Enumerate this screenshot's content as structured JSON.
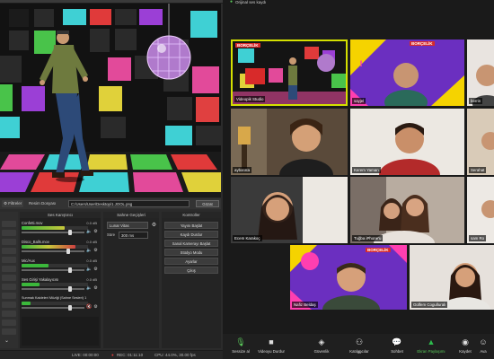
{
  "obs": {
    "filter_tab": "Filtreler",
    "image_file_label": "Resim Dosyası",
    "image_path": "C:/Users/User/Desktop/1.JOOL.png",
    "browse_label": "Gözat",
    "panels": {
      "mixer": "Ses Karıştırıcı",
      "transitions": "Sahne Geçişleri",
      "controls": "Kontroller"
    },
    "mixer_tracks": [
      {
        "name": "Confetti.mov",
        "db": "0.0 dB"
      },
      {
        "name": "Disco_Balls.mov",
        "db": "0.0 dB"
      },
      {
        "name": "Mic/Aux",
        "db": "0.0 dB"
      },
      {
        "name": "Ses Girişi Yakalayıcısı",
        "db": "0.0 dB"
      },
      {
        "name": "Sunmak Kaideleri Müziği (Sahne Sesleri) 1",
        "db": "0.0 dB"
      }
    ],
    "transition_value": "Lunar Vitas",
    "duration_label": "Süre",
    "duration_value": "300 ms",
    "control_buttons": [
      "Yayını Başlat",
      "Kaydı Durdur",
      "Sanal Kamerayı Başlat",
      "Stüdyo Modu",
      "Ayarlar",
      "Çıkış"
    ],
    "status": {
      "live": "LIVE: 00:00:00",
      "rec": "REC: 01:11:10",
      "cpu": "CPU: 44.0%, 30.00 fps"
    }
  },
  "zoom": {
    "top_label": "Orijinal ses kaydı",
    "participants": [
      {
        "name": "Videopik Studio"
      },
      {
        "name": "sayjel"
      },
      {
        "name": "berrin"
      },
      {
        "name": "aybarata"
      },
      {
        "name": "Kerem Yaman"
      },
      {
        "name": "Serahat"
      },
      {
        "name": "Ecem Karakoç"
      },
      {
        "name": "Tuğba iPhone'u"
      },
      {
        "name": "sam Ro"
      },
      {
        "name": "Nafiz Beldaş"
      },
      {
        "name": "Gülfem Cogulluralı"
      }
    ],
    "logo_text": "BORÇELİK",
    "logo_text_short": "BORÇE",
    "toolbar": [
      {
        "label": "Sessize al",
        "icon": "mic-icon"
      },
      {
        "label": "Videoyu Durdur",
        "icon": "video-icon"
      },
      {
        "label": "Güvenlik",
        "icon": "shield-icon"
      },
      {
        "label": "Katılımcılar",
        "icon": "participants-icon",
        "count": "49"
      },
      {
        "label": "Sohbet",
        "icon": "chat-icon"
      },
      {
        "label": "Ekran Paylaşımı",
        "icon": "share-screen-icon"
      },
      {
        "label": "Kaydet",
        "icon": "record-icon"
      },
      {
        "label": "Ava",
        "icon": "reactions-icon"
      }
    ],
    "colors": {
      "accent_green": "#5ac85a",
      "share_green": "#2dbb4d",
      "active_speaker": "#d4e000"
    }
  }
}
